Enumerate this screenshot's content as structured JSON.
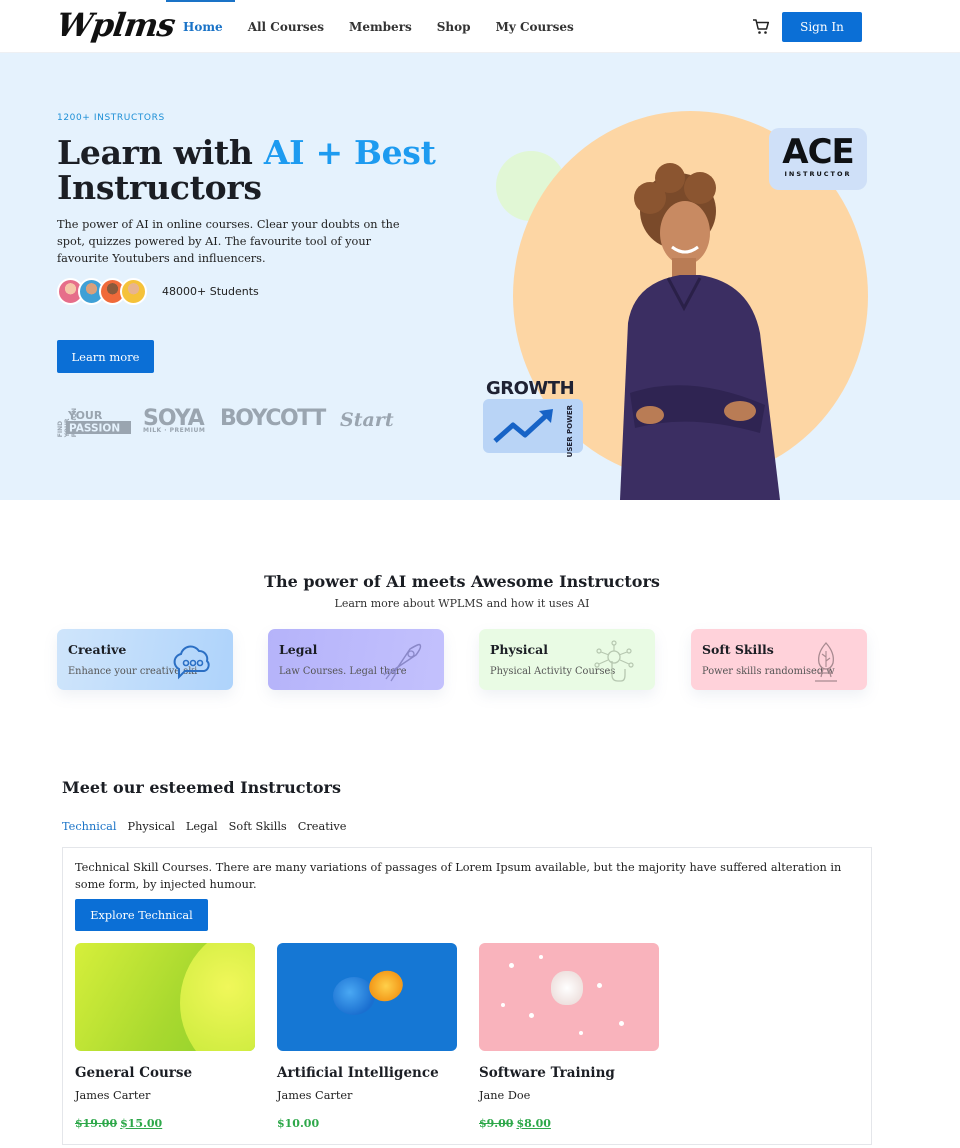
{
  "header": {
    "logo": "Wplms",
    "nav": [
      "Home",
      "All Courses",
      "Members",
      "Shop",
      "My Courses"
    ],
    "active_nav": "Home",
    "signin_label": "Sign In"
  },
  "hero": {
    "eyebrow": "1200+ INSTRUCTORS",
    "title_part1": "Learn with ",
    "title_accent": "AI + Best",
    "title_part2": "Instructors",
    "description": "The power of AI in online courses. Clear your doubts on the spot, quizzes powered by AI. The favourite tool of your favourite Youtubers and influencers.",
    "students": "48000+ Students",
    "learn_more": "Learn more",
    "brands": [
      "FIND YOUR PASSION",
      "SOYA",
      "BOYCOTT",
      "Start"
    ],
    "ace_badge": "ACE",
    "ace_sub": "INSTRUCTOR",
    "growth_label": "GROWTH",
    "user_power": "USER POWER",
    "colors": {
      "accent": "#1d9bf0",
      "background": "#e5f2fd",
      "button": "#0b6fd6"
    }
  },
  "ai_section": {
    "title": "The power of AI meets Awesome Instructors",
    "subtitle": "Learn more about WPLMS and how it uses AI",
    "categories": [
      {
        "title": "Creative",
        "description": "Enhance your creative ski",
        "icon": "chat-cloud-icon",
        "color": "#c9e2fb"
      },
      {
        "title": "Legal",
        "description": "Law Courses. Legal there",
        "icon": "rocket-icon",
        "color": "#b9b7fb"
      },
      {
        "title": "Physical",
        "description": "Physical Activity Courses",
        "icon": "touch-network-icon",
        "color": "#e8fbe3"
      },
      {
        "title": "Soft Skills",
        "description": "Power skills randomised w",
        "icon": "lamp-icon",
        "color": "#ffd3dc"
      }
    ]
  },
  "instructors": {
    "title": "Meet our esteemed Instructors",
    "tabs": [
      "Technical",
      "Physical",
      "Legal",
      "Soft Skills",
      "Creative"
    ],
    "active_tab": "Technical",
    "panel_text": "Technical Skill Courses. There are many variations of passages of Lorem Ipsum available, but the majority have suffered alteration in some form, by injected humour.",
    "explore_label": "Explore Technical",
    "courses": [
      {
        "name": "General Course",
        "instructor": "James Carter",
        "old_price": "$19.00",
        "price": "$15.00"
      },
      {
        "name": "Artificial Intelligence",
        "instructor": "James Carter",
        "old_price": "",
        "price": "$10.00"
      },
      {
        "name": "Software Training",
        "instructor": "Jane Doe",
        "old_price": "$9.00",
        "price": "$8.00"
      }
    ]
  }
}
